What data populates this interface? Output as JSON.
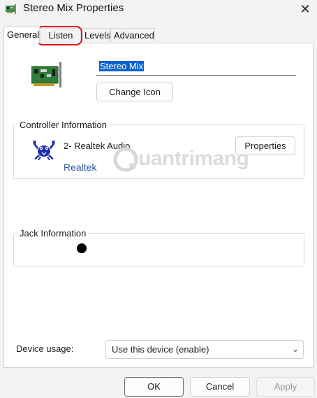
{
  "window": {
    "title": "Stereo Mix Properties",
    "close_glyph": "✕",
    "icon": "sound-card-icon"
  },
  "tabs": [
    {
      "label": "General",
      "active": true
    },
    {
      "label": "Listen",
      "active": false,
      "highlighted": true
    },
    {
      "label": "Levels",
      "active": false
    },
    {
      "label": "Advanced",
      "active": false
    }
  ],
  "general": {
    "device_name_value": "Stereo Mix",
    "change_icon_label": "Change Icon",
    "controller": {
      "legend": "Controller Information",
      "name": "2- Realtek Audio",
      "vendor": "Realtek",
      "properties_label": "Properties",
      "logo_icon": "realtek-crab-icon"
    },
    "jack": {
      "legend": "Jack Information"
    },
    "device_usage": {
      "label": "Device usage:",
      "selected": "Use this device (enable)",
      "chevron": "⌄"
    }
  },
  "footer": {
    "ok_label": "OK",
    "cancel_label": "Cancel",
    "apply_label": "Apply"
  },
  "watermark": {
    "text": "uantrimang"
  },
  "colors": {
    "highlight_ring": "#e2121b",
    "selection": "#0a63cf",
    "vendor_link": "#2f55a4"
  }
}
